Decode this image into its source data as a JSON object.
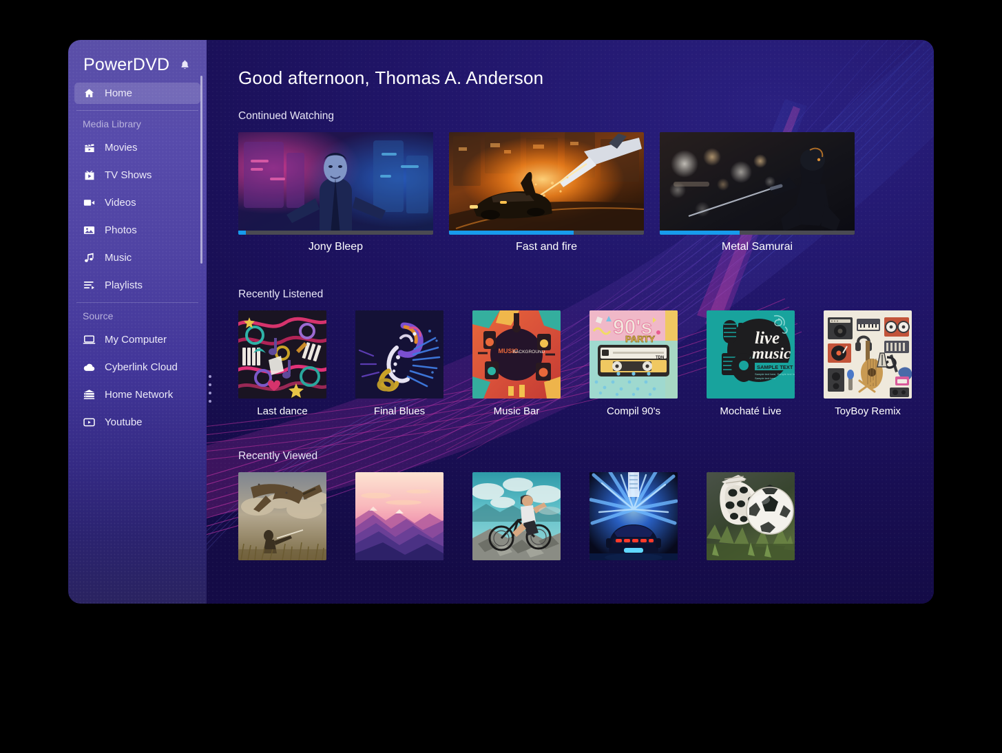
{
  "app": {
    "title": "PowerDVD",
    "notification_icon": "bell-icon"
  },
  "sidebar": {
    "primary": [
      {
        "id": "home",
        "label": "Home",
        "icon": "home-icon",
        "active": true
      }
    ],
    "groups": [
      {
        "title": "Media Library",
        "items": [
          {
            "id": "movies",
            "label": "Movies",
            "icon": "clapperboard-icon"
          },
          {
            "id": "tv-shows",
            "label": "TV Shows",
            "icon": "tv-icon"
          },
          {
            "id": "videos",
            "label": "Videos",
            "icon": "video-camera-icon"
          },
          {
            "id": "photos",
            "label": "Photos",
            "icon": "photo-icon"
          },
          {
            "id": "music",
            "label": "Music",
            "icon": "music-note-icon"
          },
          {
            "id": "playlists",
            "label": "Playlists",
            "icon": "playlist-icon"
          }
        ]
      },
      {
        "title": "Source",
        "items": [
          {
            "id": "my-computer",
            "label": "My Computer",
            "icon": "laptop-icon"
          },
          {
            "id": "cyberlink-cloud",
            "label": "Cyberlink Cloud",
            "icon": "cloud-icon"
          },
          {
            "id": "home-network",
            "label": "Home Network",
            "icon": "server-icon"
          },
          {
            "id": "youtube",
            "label": "Youtube",
            "icon": "youtube-icon"
          }
        ]
      }
    ]
  },
  "main": {
    "greeting_prefix": "Good afternoon,",
    "greeting_name": "Thomas A. Anderson",
    "sections": {
      "continued_watching": {
        "title": "Continued Watching",
        "items": [
          {
            "title": "Jony Bleep",
            "progress_percent": 4,
            "art": "cyberpunk-man-neon"
          },
          {
            "title": "Fast and fire",
            "progress_percent": 64,
            "art": "car-chase-fire"
          },
          {
            "title": "Metal Samurai",
            "progress_percent": 41,
            "art": "samurai-night-city"
          }
        ]
      },
      "recently_listened": {
        "title": "Recently Listened",
        "items": [
          {
            "title": "Last dance",
            "art": "doodle-music-collage"
          },
          {
            "title": "Final Blues",
            "art": "saxophone-player"
          },
          {
            "title": "Music Bar",
            "art": "music-background-burst"
          },
          {
            "title": "Compil 90's",
            "art": "ninetys-party-cassette"
          },
          {
            "title": "Mochaté Live",
            "art": "live-music-poster"
          },
          {
            "title": "ToyBoy Remix",
            "art": "instruments-flatlay"
          }
        ]
      },
      "recently_viewed": {
        "title": "Recently Viewed",
        "items": [
          {
            "art": "dragon-and-hunter"
          },
          {
            "art": "pink-purple-mountains"
          },
          {
            "art": "mountain-biker"
          },
          {
            "art": "sports-car-tunnel"
          },
          {
            "art": "soccer-boots-ball"
          }
        ]
      }
    }
  },
  "colors": {
    "sidebar_top": "#5a4fa8",
    "sidebar_bottom": "#2a2360",
    "main_bg": "#1d1060",
    "accent_progress": "#179bec",
    "progress_track": "#4a4a52",
    "text_primary": "#ffffff",
    "text_muted": "#b9b3dc",
    "swoosh_magenta": "#b2279c",
    "swoosh_blue": "#4a62d8"
  }
}
